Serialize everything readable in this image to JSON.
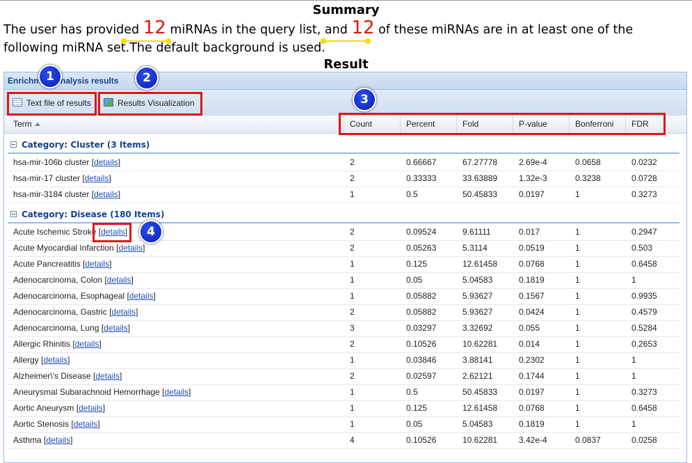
{
  "summary": {
    "title": "Summary",
    "text_1": "The user has provided ",
    "provided_count": "12",
    "text_2": " miRNAs in the query list, and ",
    "matched_count": "12",
    "text_3": " of these miRNAs are in at least one of the following miRNA set.The default background is used."
  },
  "result": {
    "title": "Result"
  },
  "panel": {
    "title": "Enrichment analysis results",
    "buttons": {
      "text_file": "Text file of results",
      "visualization": "Results Visualization"
    }
  },
  "grid": {
    "columns": {
      "term": "Term",
      "count": "Count",
      "percent": "Percent",
      "fold": "Fold",
      "pvalue": "P-value",
      "bonferroni": "Bonferroni",
      "fdr": "FDR"
    },
    "details_label": "details",
    "categories": [
      {
        "label": "Category: Cluster (3 Items)",
        "rows": [
          {
            "term": "hsa-mir-106b cluster",
            "count": "2",
            "percent": "0.66667",
            "fold": "67.27778",
            "pvalue": "2.69e-4",
            "bonferroni": "0.0658",
            "fdr": "0.0232"
          },
          {
            "term": "hsa-mir-17 cluster",
            "count": "2",
            "percent": "0.33333",
            "fold": "33.63889",
            "pvalue": "1.32e-3",
            "bonferroni": "0.3238",
            "fdr": "0.0728"
          },
          {
            "term": "hsa-mir-3184 cluster",
            "count": "1",
            "percent": "0.5",
            "fold": "50.45833",
            "pvalue": "0.0197",
            "bonferroni": "1",
            "fdr": "0.3273"
          }
        ]
      },
      {
        "label": "Category: Disease (180 Items)",
        "rows": [
          {
            "term": "Acute Ischemic Stroke",
            "count": "2",
            "percent": "0.09524",
            "fold": "9.61111",
            "pvalue": "0.017",
            "bonferroni": "1",
            "fdr": "0.2947"
          },
          {
            "term": "Acute Myocardial Infarction",
            "count": "2",
            "percent": "0.05263",
            "fold": "5.3114",
            "pvalue": "0.0519",
            "bonferroni": "1",
            "fdr": "0.503"
          },
          {
            "term": "Acute Pancreatitis",
            "count": "1",
            "percent": "0.125",
            "fold": "12.61458",
            "pvalue": "0.0768",
            "bonferroni": "1",
            "fdr": "0.6458"
          },
          {
            "term": "Adenocarcinoma, Colon",
            "count": "1",
            "percent": "0.05",
            "fold": "5.04583",
            "pvalue": "0.1819",
            "bonferroni": "1",
            "fdr": "1"
          },
          {
            "term": "Adenocarcinoma, Esophageal",
            "count": "1",
            "percent": "0.05882",
            "fold": "5.93627",
            "pvalue": "0.1567",
            "bonferroni": "1",
            "fdr": "0.9935"
          },
          {
            "term": "Adenocarcinoma, Gastric",
            "count": "2",
            "percent": "0.05882",
            "fold": "5.93627",
            "pvalue": "0.0424",
            "bonferroni": "1",
            "fdr": "0.4579"
          },
          {
            "term": "Adenocarcinoma, Lung",
            "count": "3",
            "percent": "0.03297",
            "fold": "3.32692",
            "pvalue": "0.055",
            "bonferroni": "1",
            "fdr": "0.5284"
          },
          {
            "term": "Allergic Rhinitis",
            "count": "2",
            "percent": "0.10526",
            "fold": "10.62281",
            "pvalue": "0.014",
            "bonferroni": "1",
            "fdr": "0.2653"
          },
          {
            "term": "Allergy",
            "count": "1",
            "percent": "0.03846",
            "fold": "3.88141",
            "pvalue": "0.2302",
            "bonferroni": "1",
            "fdr": "1"
          },
          {
            "term": "Alzheimer\\'s Disease",
            "count": "2",
            "percent": "0.02597",
            "fold": "2.62121",
            "pvalue": "0.1744",
            "bonferroni": "1",
            "fdr": "1"
          },
          {
            "term": "Aneurysmal Subarachnoid Hemorrhage",
            "count": "1",
            "percent": "0.5",
            "fold": "50.45833",
            "pvalue": "0.0197",
            "bonferroni": "1",
            "fdr": "0.3273"
          },
          {
            "term": "Aortic Aneurysm",
            "count": "1",
            "percent": "0.125",
            "fold": "12.61458",
            "pvalue": "0.0768",
            "bonferroni": "1",
            "fdr": "0.6458"
          },
          {
            "term": "Aortic Stenosis",
            "count": "1",
            "percent": "0.05",
            "fold": "5.04583",
            "pvalue": "0.1819",
            "bonferroni": "1",
            "fdr": "1"
          },
          {
            "term": "Asthma",
            "count": "4",
            "percent": "0.10526",
            "fold": "10.62281",
            "pvalue": "3.42e-4",
            "bonferroni": "0.0837",
            "fdr": "0.0258"
          }
        ]
      }
    ]
  },
  "annotations": {
    "badge_1": "1",
    "badge_2": "2",
    "badge_3": "3",
    "badge_4": "4"
  },
  "colors": {
    "highlight_number": "#e3170d",
    "annotation_box": "#e01515",
    "badge": "#0a1db0",
    "link": "#1e50b4",
    "header_text": "#15428b"
  }
}
